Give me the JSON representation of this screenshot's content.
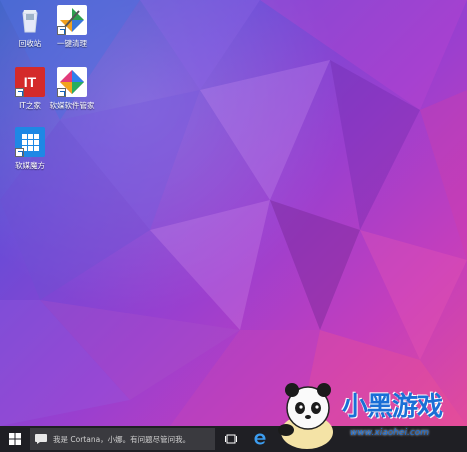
{
  "desktop": {
    "icons": [
      {
        "label": "回收站",
        "icon": "recycle-bin-icon"
      },
      {
        "label": "一键清理",
        "icon": "broom-cleanup-icon"
      },
      {
        "label": "IT之家",
        "icon": "ithome-app-icon",
        "logo_text": "IT"
      },
      {
        "label": "软媒软件管家",
        "icon": "software-manager-icon"
      },
      {
        "label": "软媒魔方",
        "icon": "rubik-cube-app-icon"
      }
    ]
  },
  "taskbar": {
    "start_icon": "windows-logo-icon",
    "search_placeholder": "我是 Cortana，小娜。有问题尽管问我。",
    "task_view_icon": "task-view-icon",
    "edge_icon": "edge-browser-icon"
  },
  "watermark": {
    "title": "小黑游戏",
    "url": "www.xiaohei.com"
  },
  "colors": {
    "taskbar": "#1f1f24",
    "search_box": "#3a3a3f",
    "accent": "#1a6fd6"
  }
}
